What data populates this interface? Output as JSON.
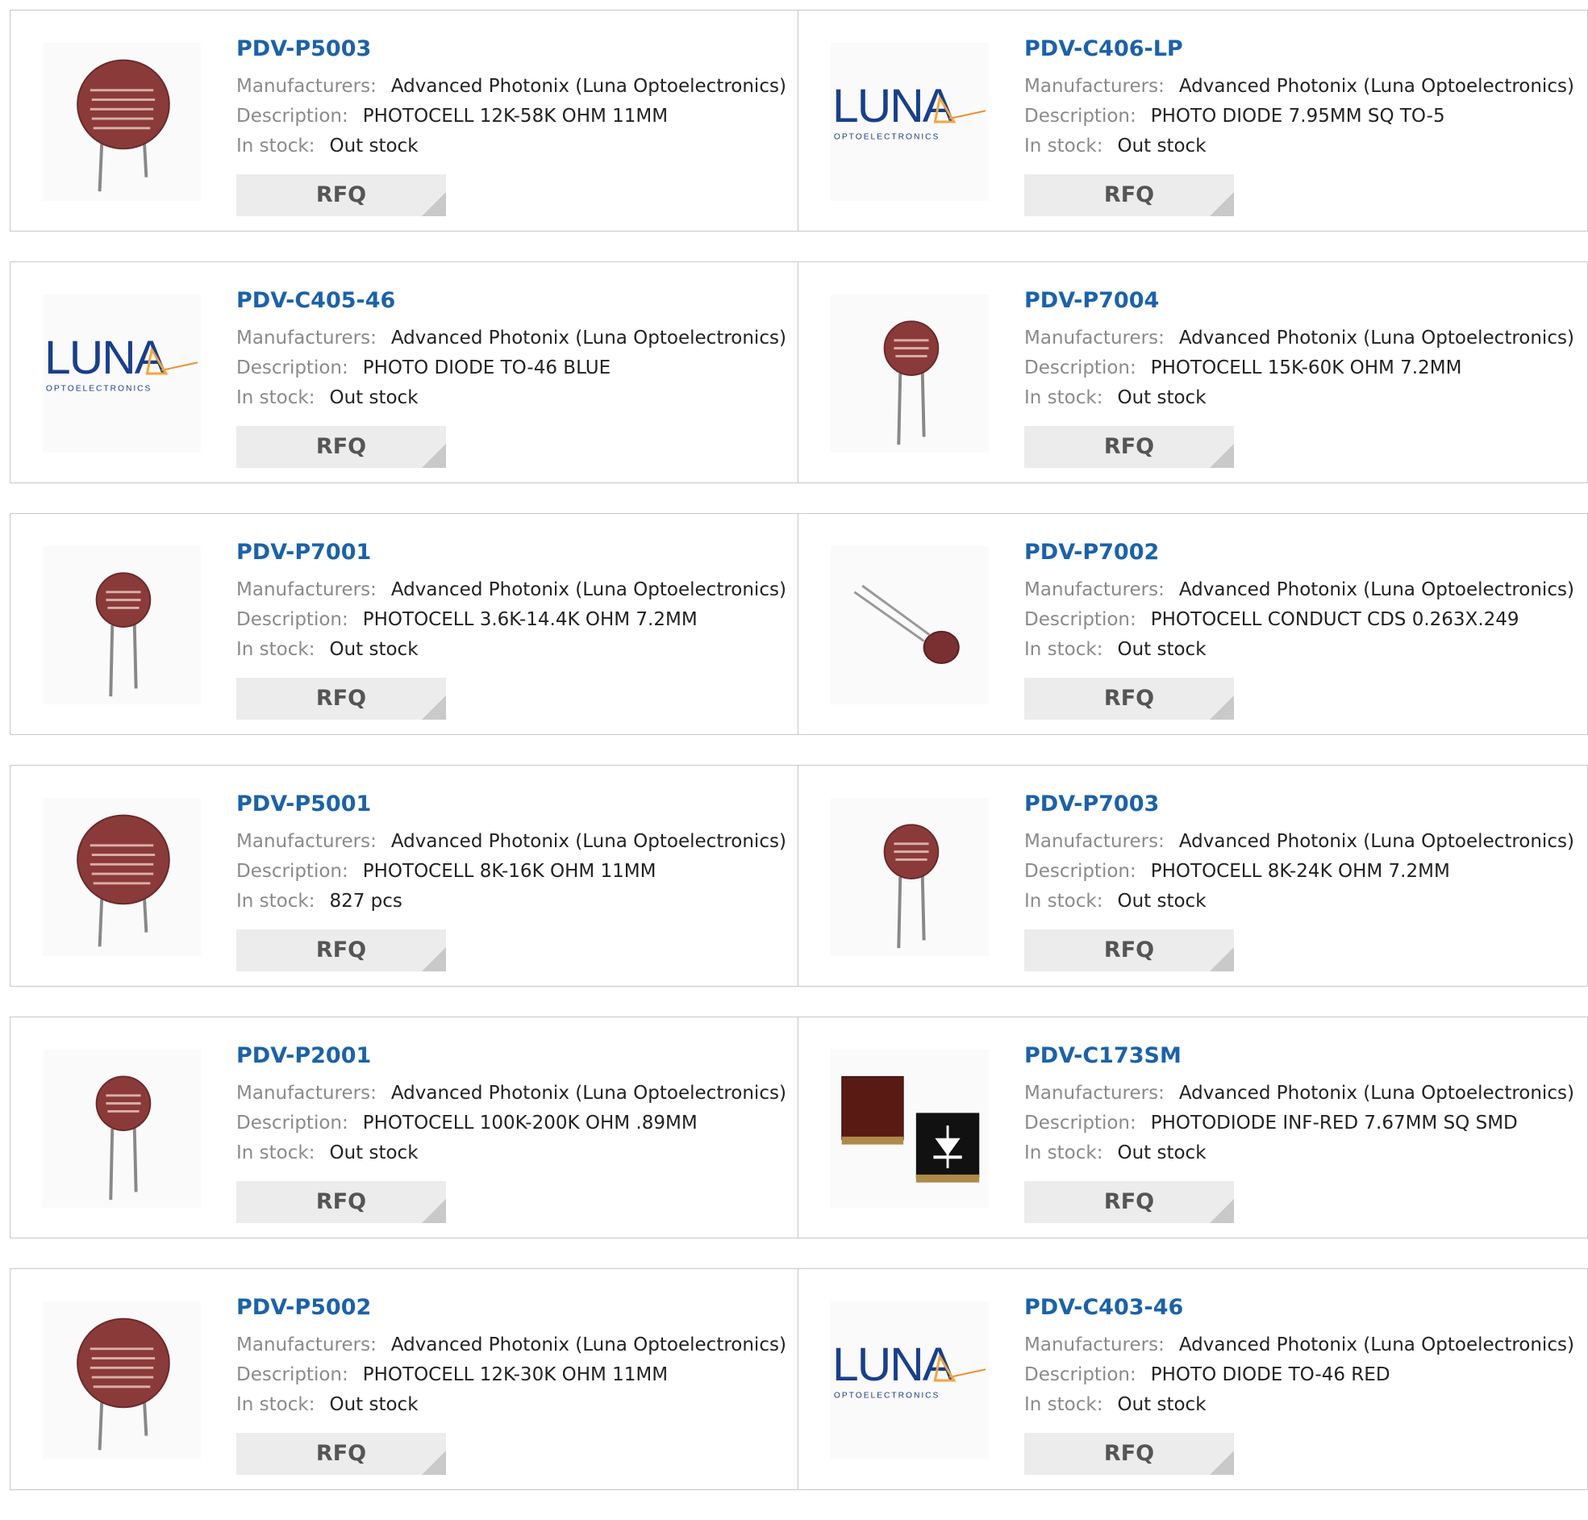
{
  "labels": {
    "manufacturers": "Manufacturers:",
    "description": "Description:",
    "in_stock": "In stock:",
    "rfq": "RFQ"
  },
  "logo": {
    "brand": "LUNA",
    "tagline": "OPTOELECTRONICS"
  },
  "colors": {
    "title": "#1c62a8",
    "button_bg": "#ececec",
    "border": "#c8c8c8"
  },
  "products": [
    {
      "part": "PDV-P5003",
      "manufacturer": "Advanced Photonix (Luna Optoelectronics)",
      "description": "PHOTOCELL 12K-58K OHM 11MM",
      "stock": "Out stock",
      "image": "photocell-large"
    },
    {
      "part": "PDV-C406-LP",
      "manufacturer": "Advanced Photonix (Luna Optoelectronics)",
      "description": "PHOTO DIODE 7.95MM SQ TO-5",
      "stock": "Out stock",
      "image": "luna-logo"
    },
    {
      "part": "PDV-C405-46",
      "manufacturer": "Advanced Photonix (Luna Optoelectronics)",
      "description": "PHOTO DIODE TO-46 BLUE",
      "stock": "Out stock",
      "image": "luna-logo"
    },
    {
      "part": "PDV-P7004",
      "manufacturer": "Advanced Photonix (Luna Optoelectronics)",
      "description": "PHOTOCELL 15K-60K OHM 7.2MM",
      "stock": "Out stock",
      "image": "photocell-small"
    },
    {
      "part": "PDV-P7001",
      "manufacturer": "Advanced Photonix (Luna Optoelectronics)",
      "description": "PHOTOCELL 3.6K-14.4K OHM 7.2MM",
      "stock": "Out stock",
      "image": "photocell-small"
    },
    {
      "part": "PDV-P7002",
      "manufacturer": "Advanced Photonix (Luna Optoelectronics)",
      "description": "PHOTOCELL CONDUCT CDS 0.263X.249",
      "stock": "Out stock",
      "image": "photocell-side"
    },
    {
      "part": "PDV-P5001",
      "manufacturer": "Advanced Photonix (Luna Optoelectronics)",
      "description": "PHOTOCELL 8K-16K OHM 11MM",
      "stock": "827 pcs",
      "image": "photocell-large"
    },
    {
      "part": "PDV-P7003",
      "manufacturer": "Advanced Photonix (Luna Optoelectronics)",
      "description": "PHOTOCELL 8K-24K OHM 7.2MM",
      "stock": "Out stock",
      "image": "photocell-small"
    },
    {
      "part": "PDV-P2001",
      "manufacturer": "Advanced Photonix (Luna Optoelectronics)",
      "description": "PHOTOCELL 100K-200K OHM .89MM",
      "stock": "Out stock",
      "image": "photocell-small"
    },
    {
      "part": "PDV-C173SM",
      "manufacturer": "Advanced Photonix (Luna Optoelectronics)",
      "description": "PHOTODIODE INF-RED 7.67MM SQ SMD",
      "stock": "Out stock",
      "image": "smd-photodiode"
    },
    {
      "part": "PDV-P5002",
      "manufacturer": "Advanced Photonix (Luna Optoelectronics)",
      "description": "PHOTOCELL 12K-30K OHM 11MM",
      "stock": "Out stock",
      "image": "photocell-large"
    },
    {
      "part": "PDV-C403-46",
      "manufacturer": "Advanced Photonix (Luna Optoelectronics)",
      "description": "PHOTO DIODE TO-46 RED",
      "stock": "Out stock",
      "image": "luna-logo"
    }
  ]
}
